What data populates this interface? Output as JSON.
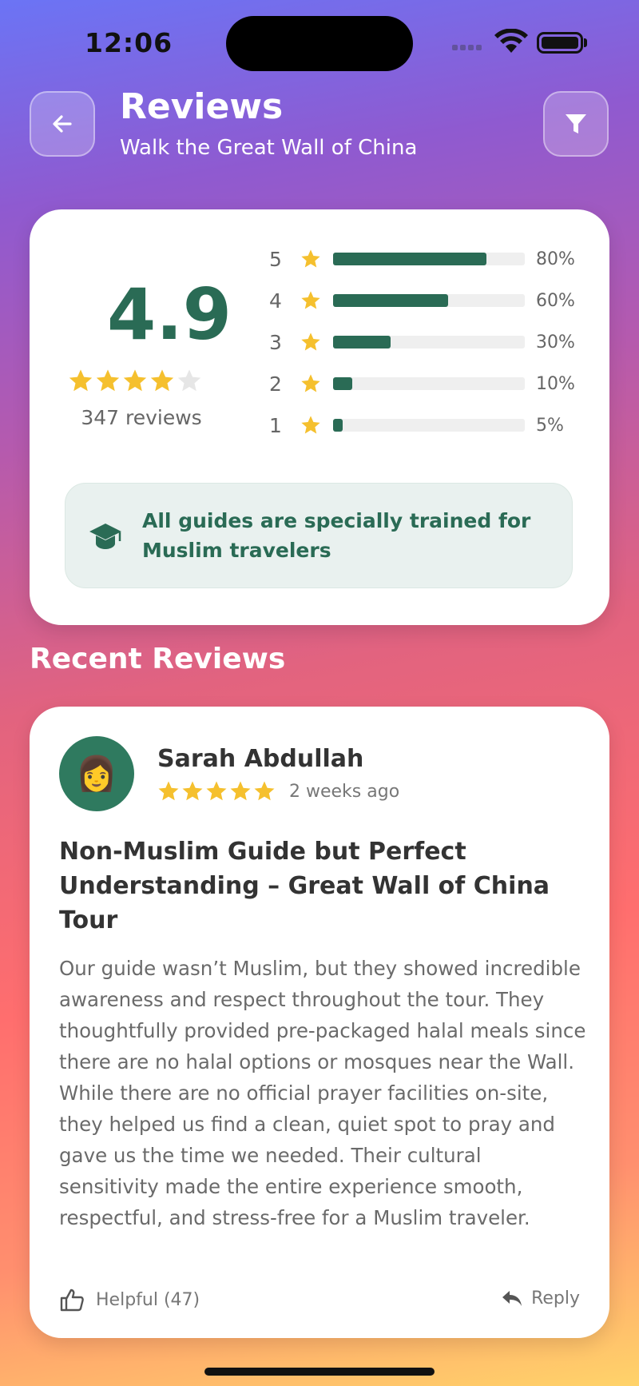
{
  "status_bar": {
    "time": "12:06"
  },
  "header": {
    "title": "Reviews",
    "subtitle": "Walk the Great Wall of China",
    "back_icon": "arrow-left-icon",
    "filter_icon": "filter-funnel-icon"
  },
  "summary": {
    "rating": "4.9",
    "stars_filled": 4,
    "stars_total": 5,
    "review_count": "347 reviews",
    "breakdown": [
      {
        "stars": "5",
        "percent": 80,
        "label": "80%"
      },
      {
        "stars": "4",
        "percent": 60,
        "label": "60%"
      },
      {
        "stars": "3",
        "percent": 30,
        "label": "30%"
      },
      {
        "stars": "2",
        "percent": 10,
        "label": "10%"
      },
      {
        "stars": "1",
        "percent": 5,
        "label": "5%"
      }
    ],
    "guide_banner": {
      "icon": "graduation-cap-icon",
      "text": "All guides are specially trained for Muslim travelers"
    }
  },
  "recent_reviews": {
    "title": "Recent Reviews",
    "items": [
      {
        "avatar": "👩",
        "name": "Sarah Abdullah",
        "stars": 5,
        "date": "2 weeks ago",
        "title": "Non-Muslim Guide but Perfect Understanding – Great Wall of China Tour",
        "body": "Our guide wasn’t Muslim, but they showed incredible awareness and respect throughout the tour. They thoughtfully provided pre-packaged halal meals since there are no halal options or mosques near the Wall. While there are no official prayer facilities on-site, they helped us find a clean, quiet spot to pray and gave us the time we needed. Their cultural sensitivity made the entire experience smooth, respectful, and stress-free for a Muslim traveler.",
        "helpful_label": "Helpful (47)",
        "reply_label": "Reply"
      }
    ]
  },
  "colors": {
    "accent": "#2a6b55",
    "star": "#f5c02e",
    "star_empty": "#e6e6e6"
  }
}
